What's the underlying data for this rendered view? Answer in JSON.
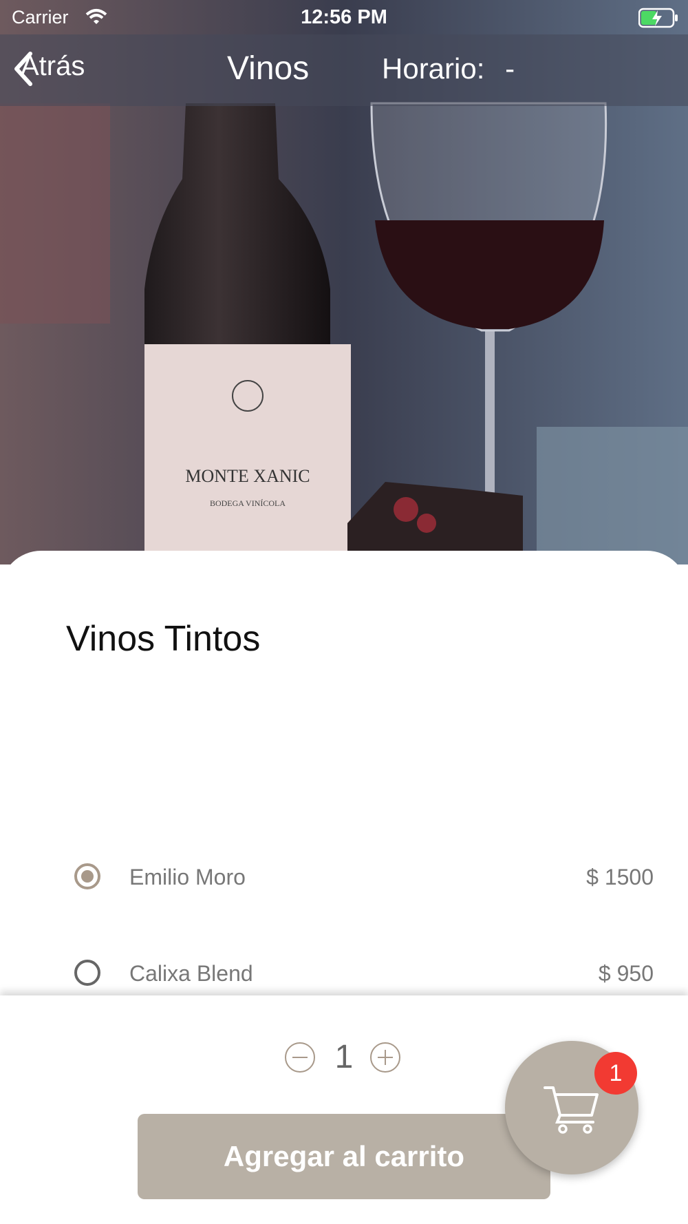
{
  "status_bar": {
    "carrier": "Carrier",
    "time": "12:56 PM"
  },
  "nav": {
    "back_label": "Atrás",
    "title": "Vinos",
    "schedule_label": "Horario:",
    "schedule_value": "-"
  },
  "product": {
    "title": "Vinos Tintos",
    "options": [
      {
        "name": "Emilio Moro",
        "price": "$ 1500",
        "selected": true
      },
      {
        "name": "Calixa Blend",
        "price": "$ 950",
        "selected": false
      }
    ]
  },
  "hero_image": {
    "bottle_brand": "MONTE XANIC",
    "bottle_sub": "BODEGA VINÍCOLA"
  },
  "cart": {
    "quantity": "1",
    "add_label": "Agregar al carrito",
    "badge_count": "1"
  },
  "colors": {
    "accent": "#b8b0a5",
    "radio_selected": "#a8998a",
    "badge": "#f23a32"
  }
}
